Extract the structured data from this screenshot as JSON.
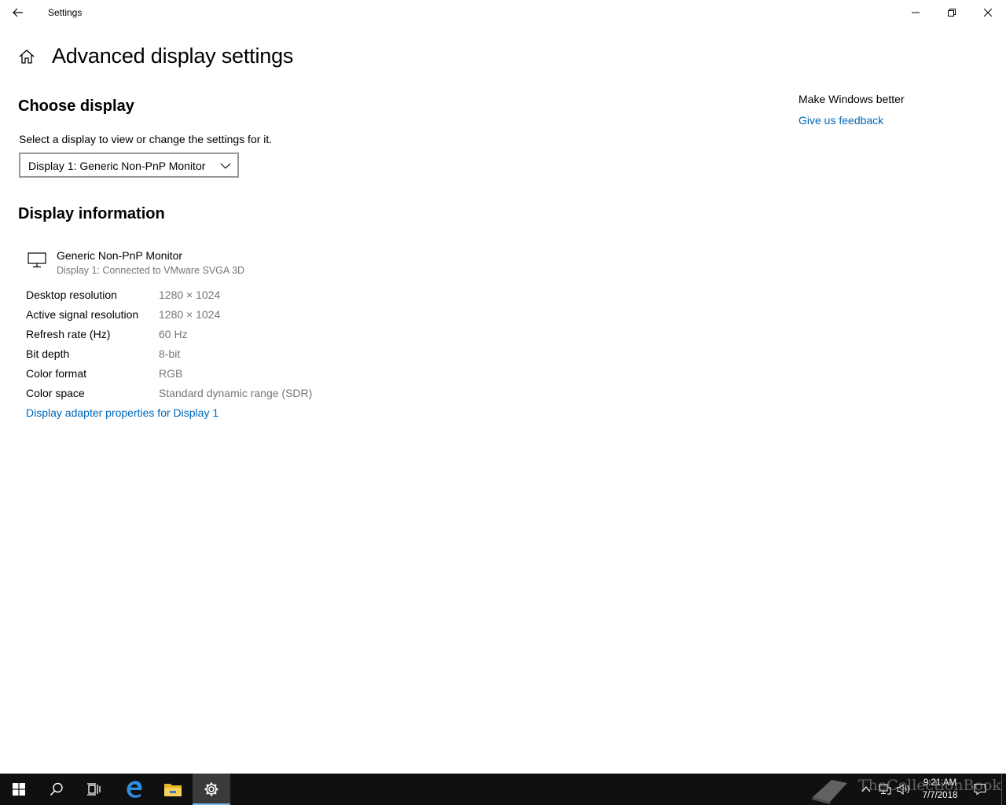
{
  "window": {
    "title": "Settings"
  },
  "header": {
    "title": "Advanced display settings"
  },
  "choose_display": {
    "heading": "Choose display",
    "description": "Select a display to view or change the settings for it.",
    "selected_display": "Display 1: Generic Non-PnP Monitor"
  },
  "display_info": {
    "heading": "Display information",
    "monitor_name": "Generic Non-PnP Monitor",
    "monitor_connection": "Display 1: Connected to VMware SVGA 3D",
    "rows": [
      {
        "label": "Desktop resolution",
        "value": "1280 × 1024"
      },
      {
        "label": "Active signal resolution",
        "value": "1280 × 1024"
      },
      {
        "label": "Refresh rate (Hz)",
        "value": "60 Hz"
      },
      {
        "label": "Bit depth",
        "value": "8-bit"
      },
      {
        "label": "Color format",
        "value": "RGB"
      },
      {
        "label": "Color space",
        "value": "Standard dynamic range (SDR)"
      }
    ],
    "adapter_link": "Display adapter properties for Display 1"
  },
  "sidebar": {
    "heading": "Make Windows better",
    "feedback_link": "Give us feedback"
  },
  "taskbar": {
    "apps": [
      "start-icon",
      "search-icon",
      "task-view-icon",
      "edge-icon",
      "file-explorer-icon",
      "settings-icon"
    ],
    "clock_time": "9:21 AM",
    "clock_date": "7/7/2018"
  },
  "watermark": {
    "text": "TheCollectionBook"
  },
  "colors": {
    "link": "#0067b8",
    "secondary_text": "#767676",
    "taskbar": "#101010",
    "active_app_underline": "#76b9ed"
  }
}
